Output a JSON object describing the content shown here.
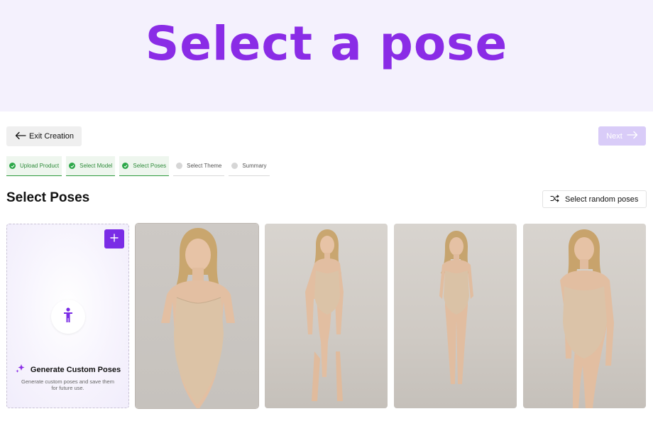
{
  "hero": {
    "title": "Select a pose"
  },
  "nav": {
    "exit_label": "Exit Creation",
    "next_label": "Next"
  },
  "steps": [
    {
      "label": "Upload Product",
      "status": "done"
    },
    {
      "label": "Select Model",
      "status": "done"
    },
    {
      "label": "Select Poses",
      "status": "done"
    },
    {
      "label": "Select Theme",
      "status": "pending"
    },
    {
      "label": "Summary",
      "status": "pending"
    }
  ],
  "section": {
    "title": "Select Poses",
    "random_label": "Select random poses"
  },
  "generate_card": {
    "title": "Generate Custom Poses",
    "description": "Generate custom poses and save them for future use."
  },
  "poses": [
    {
      "name": "pose-1",
      "selected": true
    },
    {
      "name": "pose-2",
      "selected": false
    },
    {
      "name": "pose-3",
      "selected": false
    },
    {
      "name": "pose-4",
      "selected": false
    }
  ],
  "colors": {
    "accent": "#8a2ce6",
    "button_purple": "#7a2ce6",
    "next_disabled": "#d9ccf8",
    "hero_bg": "#f4f1fd",
    "step_done": "#2e8b3a"
  },
  "icons": [
    "arrow-left-icon",
    "arrow-right-icon",
    "check-icon",
    "shuffle-icon",
    "plus-icon",
    "person-icon",
    "sparkle-icon"
  ]
}
